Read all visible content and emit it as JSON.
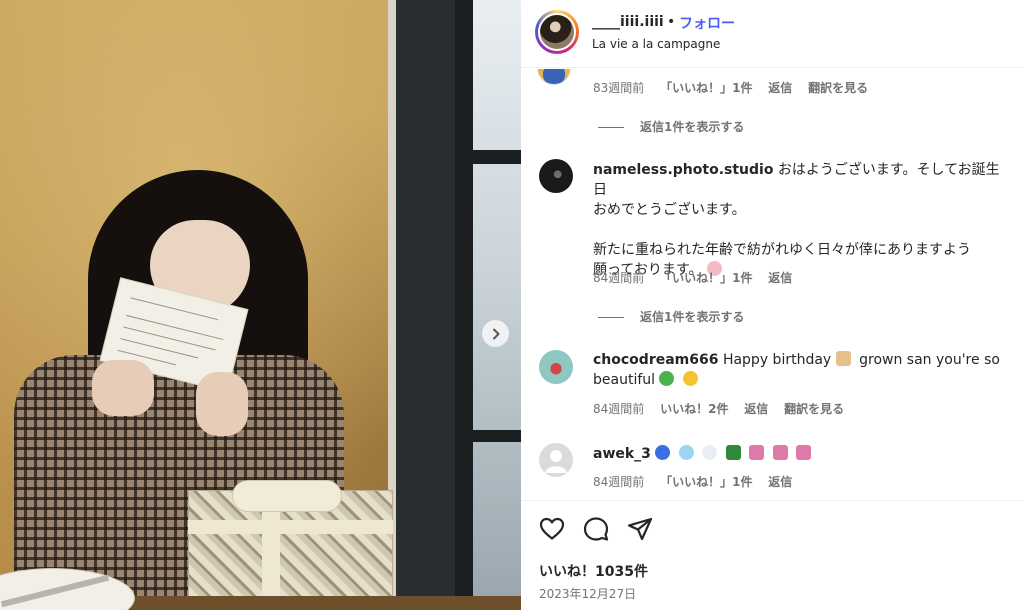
{
  "header": {
    "username": "____iiii.iiii",
    "separator": "•",
    "follow_label": "フォロー",
    "subtitle": "La vie a la campagne"
  },
  "comments": [
    {
      "partial": true,
      "time": "83週間前",
      "likes": "「いいね！」1件",
      "reply": "返信",
      "translate": "翻訳を見る",
      "view_replies": "返信1件を表示する"
    },
    {
      "username": "nameless.photo.studio",
      "lines": [
        "おはようございます。そしてお誕生日",
        "おめでとうございます。",
        "",
        "新たに重ねられた年齢で紡がれゆく日々が倖にありますよう",
        "願っております。"
      ],
      "emoji_tail": "smiling-face-with-hearts-emoji",
      "time": "84週間前",
      "likes": "「いいね！」1件",
      "reply": "返信",
      "view_replies": "返信1件を表示する"
    },
    {
      "username": "chocodream666",
      "text_a": "Happy birthday",
      "text_b": "grown san you're so",
      "text_c": "beautiful",
      "emojis": [
        "birthday-cake-emoji",
        "four-leaf-clover-emoji",
        "sparkles-emoji"
      ],
      "time": "84週間前",
      "likes": "いいね！2件",
      "reply": "返信",
      "translate": "翻訳を見る"
    },
    {
      "username": "awek_3",
      "emojis": [
        "blue-heart-emoji",
        "snowflake-emoji",
        "snowman-emoji",
        "christmas-tree-emoji",
        "bouquet-emoji",
        "bouquet-emoji",
        "bouquet-emoji"
      ],
      "time": "84週間前",
      "likes": "「いいね！」1件",
      "reply": "返信"
    }
  ],
  "actions": {
    "icons": [
      "heart-icon",
      "comment-icon",
      "share-icon"
    ],
    "likes": "いいね！1035件",
    "date": "2023年12月27日"
  },
  "colors": {
    "follow": "#4a5df9",
    "meta": "#737373",
    "text": "#262626"
  }
}
